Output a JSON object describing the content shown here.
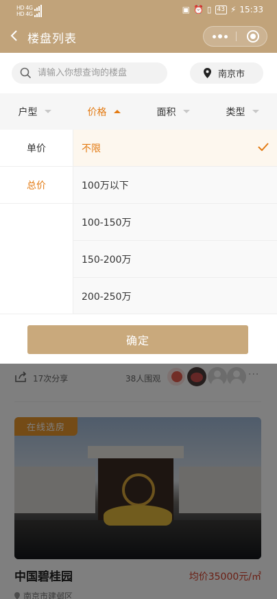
{
  "status_bar": {
    "sim1": "HD",
    "sim2": "HD",
    "net1": "4G",
    "net2": "4G",
    "battery": "43",
    "time": "15:33"
  },
  "nav": {
    "title": "楼盘列表"
  },
  "search": {
    "placeholder": "请输入你想查询的楼盘",
    "value": ""
  },
  "city": {
    "label": "南京市"
  },
  "filter_tabs": [
    {
      "label": "户型",
      "active": false
    },
    {
      "label": "价格",
      "active": true
    },
    {
      "label": "面积",
      "active": false
    },
    {
      "label": "类型",
      "active": false
    }
  ],
  "price_types": [
    {
      "label": "单价",
      "active": false
    },
    {
      "label": "总价",
      "active": true
    }
  ],
  "price_options": [
    {
      "label": "不限",
      "selected": true
    },
    {
      "label": "100万以下",
      "selected": false
    },
    {
      "label": "100-150万",
      "selected": false
    },
    {
      "label": "150-200万",
      "selected": false
    },
    {
      "label": "200-250万",
      "selected": false
    }
  ],
  "confirm_label": "确定",
  "listing": {
    "shares": "17次分享",
    "views": "38人围观",
    "more": "···",
    "badge": "在线选房",
    "name": "中国碧桂园",
    "price": "均价35000元/㎡",
    "address": "南京市建邺区"
  },
  "colors": {
    "brand": "#c1a37a",
    "accent": "#e37a12",
    "price_red": "#d43d27",
    "confirm": "#c9a97c"
  }
}
